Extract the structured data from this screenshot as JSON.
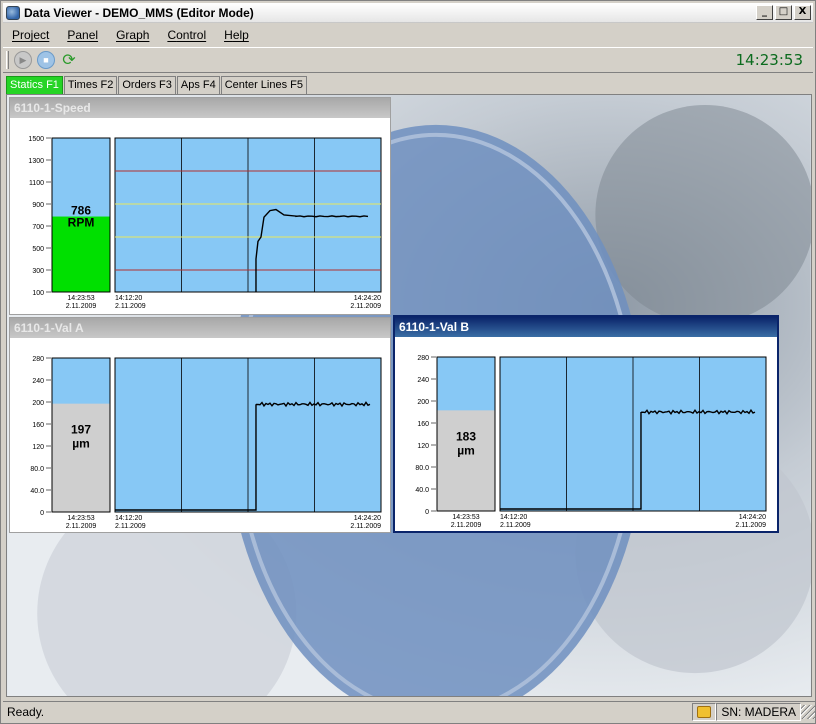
{
  "window": {
    "title": "Data Viewer - DEMO_MMS (Editor Mode)",
    "buttons": [
      "_",
      "□",
      "X"
    ]
  },
  "menu": [
    "Project",
    "Panel",
    "Graph",
    "Control",
    "Help"
  ],
  "toolbar": {
    "clock": "14:23:53"
  },
  "tabs": [
    "Statics F1",
    "Times F2",
    "Orders F3",
    "Aps F4",
    "Center Lines F5"
  ],
  "status": {
    "text": "Ready.",
    "serial": "SN: MADERA"
  },
  "colors": {
    "plot_bg": "#87c8f5",
    "bar_green": "#00e000",
    "bar_gray": "#cfcfcf",
    "limit_red": "#b03030",
    "limit_yellow": "#e8e860"
  },
  "panels": [
    {
      "title": "6110-1-Speed",
      "value": "786",
      "unit": "RPM",
      "bar_color": "green",
      "yticks": [
        "1500",
        "1300",
        "1100",
        "900",
        "700",
        "500",
        "300",
        "100"
      ],
      "ymin": 100,
      "ymax": 1500,
      "bar_value": 786,
      "now_time": "14:23:53",
      "now_date": "2.11.2009",
      "start_time": "14:12:20",
      "start_date": "2.11.2009",
      "end_time": "14:24:20",
      "end_date": "2.11.2009",
      "red_limits": [
        1200,
        300
      ],
      "yellow_limits": [
        900,
        600
      ]
    },
    {
      "title": "6110-1-Val A",
      "value": "197",
      "unit": "µm",
      "bar_color": "gray",
      "yticks": [
        "280",
        "240",
        "200",
        "160",
        "120",
        "80.0",
        "40.0",
        "0"
      ],
      "ymin": 0,
      "ymax": 280,
      "bar_value": 197,
      "now_time": "14:23:53",
      "now_date": "2.11.2009",
      "start_time": "14:12:20",
      "start_date": "2.11.2009",
      "end_time": "14:24:20",
      "end_date": "2.11.2009"
    },
    {
      "title": "6110-1-Val B",
      "value": "183",
      "unit": "µm",
      "bar_color": "gray",
      "yticks": [
        "280",
        "240",
        "200",
        "160",
        "120",
        "80.0",
        "40.0",
        "0"
      ],
      "ymin": 0,
      "ymax": 280,
      "bar_value": 183,
      "now_time": "14:23:53",
      "now_date": "2.11.2009",
      "start_time": "14:12:20",
      "start_date": "2.11.2009",
      "end_time": "14:24:20",
      "end_date": "2.11.2009"
    }
  ]
}
